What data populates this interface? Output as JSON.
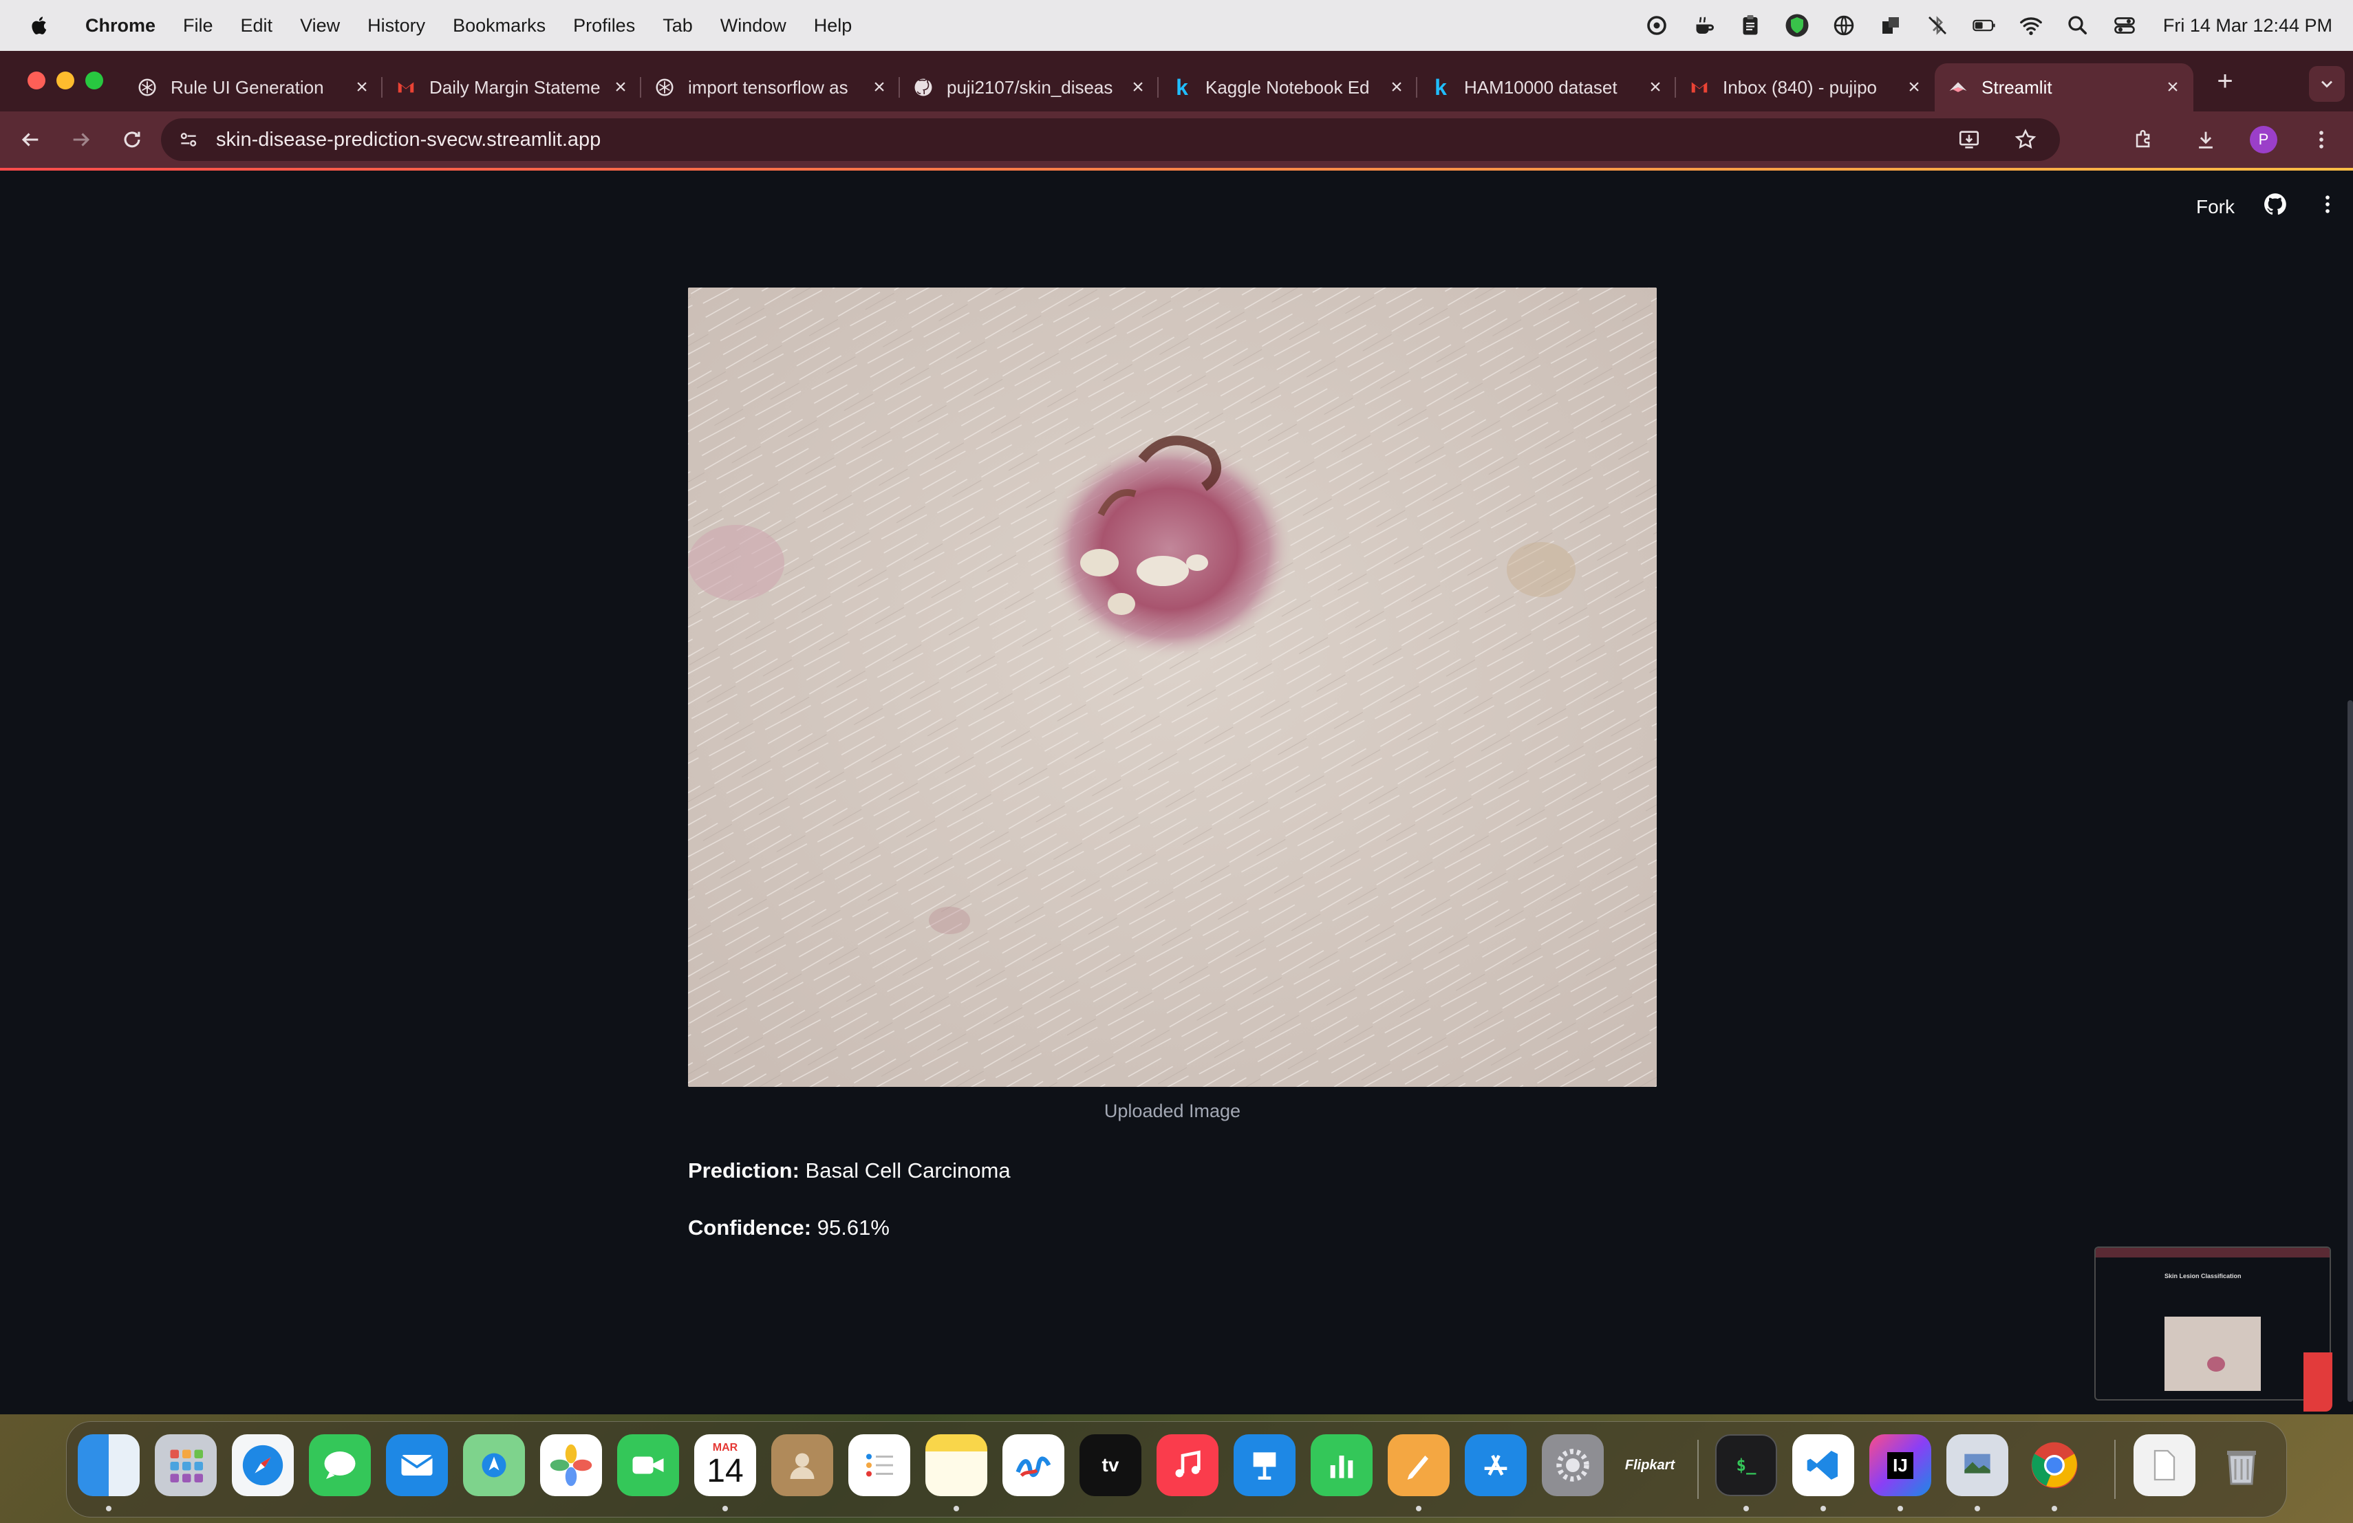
{
  "menubar": {
    "app_name": "Chrome",
    "menus": [
      "File",
      "Edit",
      "View",
      "History",
      "Bookmarks",
      "Profiles",
      "Tab",
      "Window",
      "Help"
    ],
    "clock": "Fri 14 Mar  12:44 PM",
    "status_icons": [
      "creative-cloud-icon",
      "java-icon",
      "clipboard-icon",
      "vpn-shield-icon",
      "network-globe-icon",
      "app-icon",
      "bluetooth-off-icon",
      "battery-icon",
      "wifi-icon",
      "spotlight-search-icon",
      "control-center-icon"
    ]
  },
  "browser": {
    "tabs": [
      {
        "title": "Rule UI Generation",
        "icon": "openai-icon"
      },
      {
        "title": "Daily Margin Stateme",
        "icon": "gmail-icon"
      },
      {
        "title": "import tensorflow as",
        "icon": "openai-icon"
      },
      {
        "title": "puji2107/skin_diseas",
        "icon": "github-icon"
      },
      {
        "title": "Kaggle Notebook Ed",
        "icon": "kaggle-icon"
      },
      {
        "title": "HAM10000 dataset",
        "icon": "kaggle-icon"
      },
      {
        "title": "Inbox (840) - pujipo",
        "icon": "gmail-icon"
      },
      {
        "title": "Streamlit",
        "icon": "streamlit-icon",
        "active": true
      }
    ],
    "url": "skin-disease-prediction-svecw.streamlit.app",
    "profile_initial": "P",
    "accent_color": "#5a2a34"
  },
  "app": {
    "header_fork": "Fork",
    "image_caption": "Uploaded Image",
    "prediction_label": "Prediction:",
    "prediction_value": "Basal Cell Carcinoma",
    "confidence_label": "Confidence:",
    "confidence_value": "95.61%"
  },
  "pip_preview": {
    "title": "Skin Lesion Classification"
  },
  "dock": {
    "apps": [
      "Finder",
      "Launchpad",
      "Safari",
      "Messages",
      "Mail",
      "Maps",
      "Photos",
      "FaceTime",
      "Calendar",
      "Contacts",
      "Reminders",
      "Notes",
      "Freeform",
      "TV",
      "Music",
      "Keynote",
      "Numbers",
      "Pages",
      "App Store",
      "System Settings",
      "Flipkart",
      "Terminal",
      "Visual Studio Code",
      "IntelliJ IDEA",
      "Preview",
      "Chrome",
      "Documents",
      "Trash"
    ],
    "calendar_month": "MAR",
    "calendar_day": "14"
  }
}
